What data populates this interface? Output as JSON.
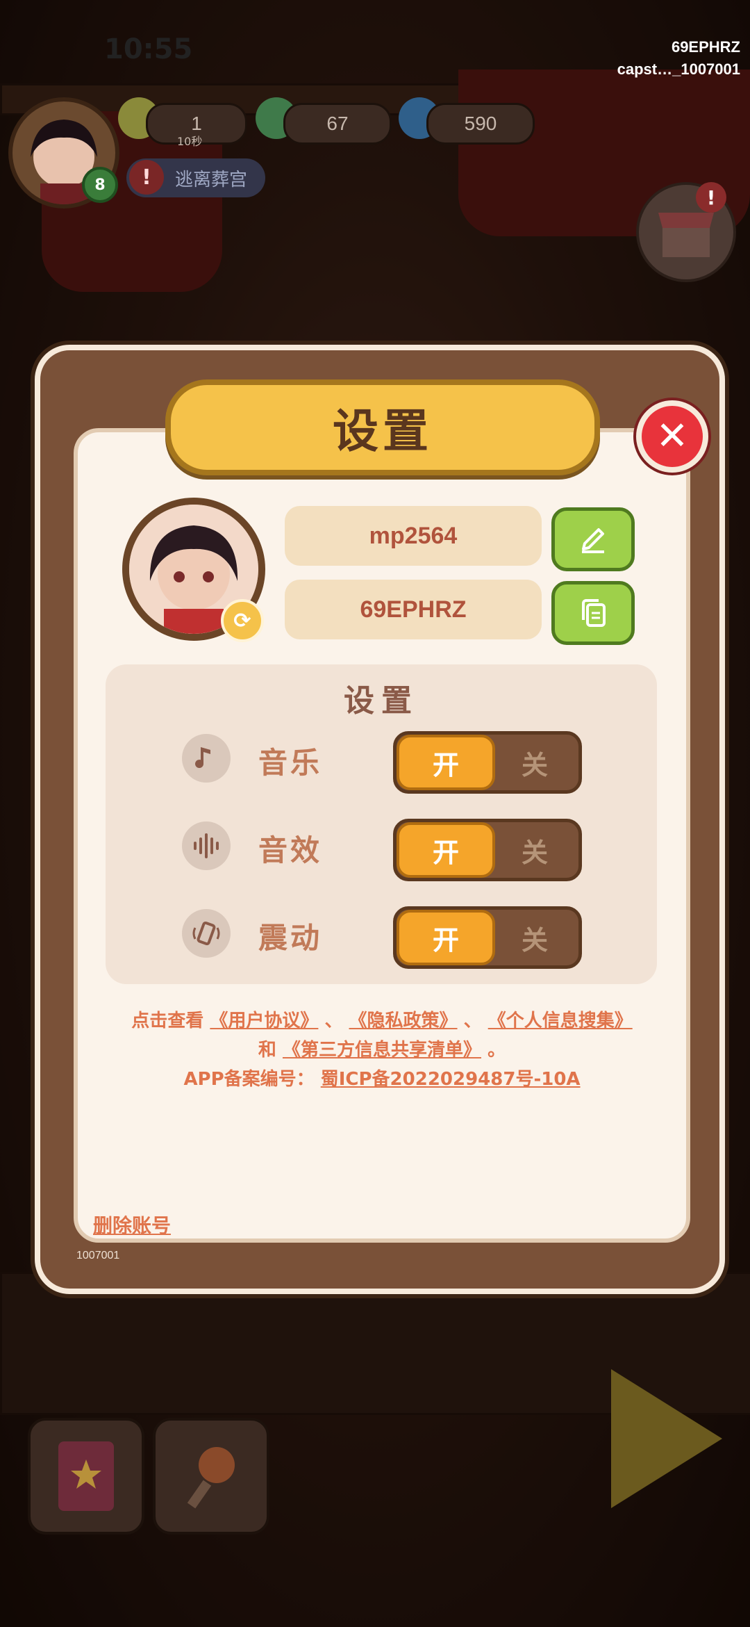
{
  "status_bar": {
    "time": "10:55",
    "right_line1": "69EPHRZ",
    "right_line2": "capst…_1007001"
  },
  "hud": {
    "level": "8",
    "energy": "1",
    "energy_timer": "10秒",
    "coins": "67",
    "fire": "590",
    "quest": "逃离葬宫",
    "quest_icon": "!",
    "shop_badge": "!"
  },
  "dialog": {
    "title": "设置",
    "close_icon": "✕",
    "username": "mp2564",
    "user_id": "69EPHRZ",
    "panel_title": "设置",
    "rows": [
      {
        "label": "音乐",
        "on": "开",
        "off": "关"
      },
      {
        "label": "音效",
        "on": "开",
        "off": "关"
      },
      {
        "label": "震动",
        "on": "开",
        "off": "关"
      }
    ],
    "legal": {
      "prefix": "点击查看",
      "user_agreement": "《用户协议》",
      "sep1": "、",
      "privacy": "《隐私政策》",
      "sep2": "、",
      "personal_info": "《个人信息搜集》",
      "and": "和",
      "third_party": "《第三方信息共享清单》",
      "end": "。",
      "icp_label": "APP备案编号：",
      "icp_number": "蜀ICP备2022029487号-10A"
    },
    "delete_account": "删除账号",
    "version": "1007001"
  }
}
